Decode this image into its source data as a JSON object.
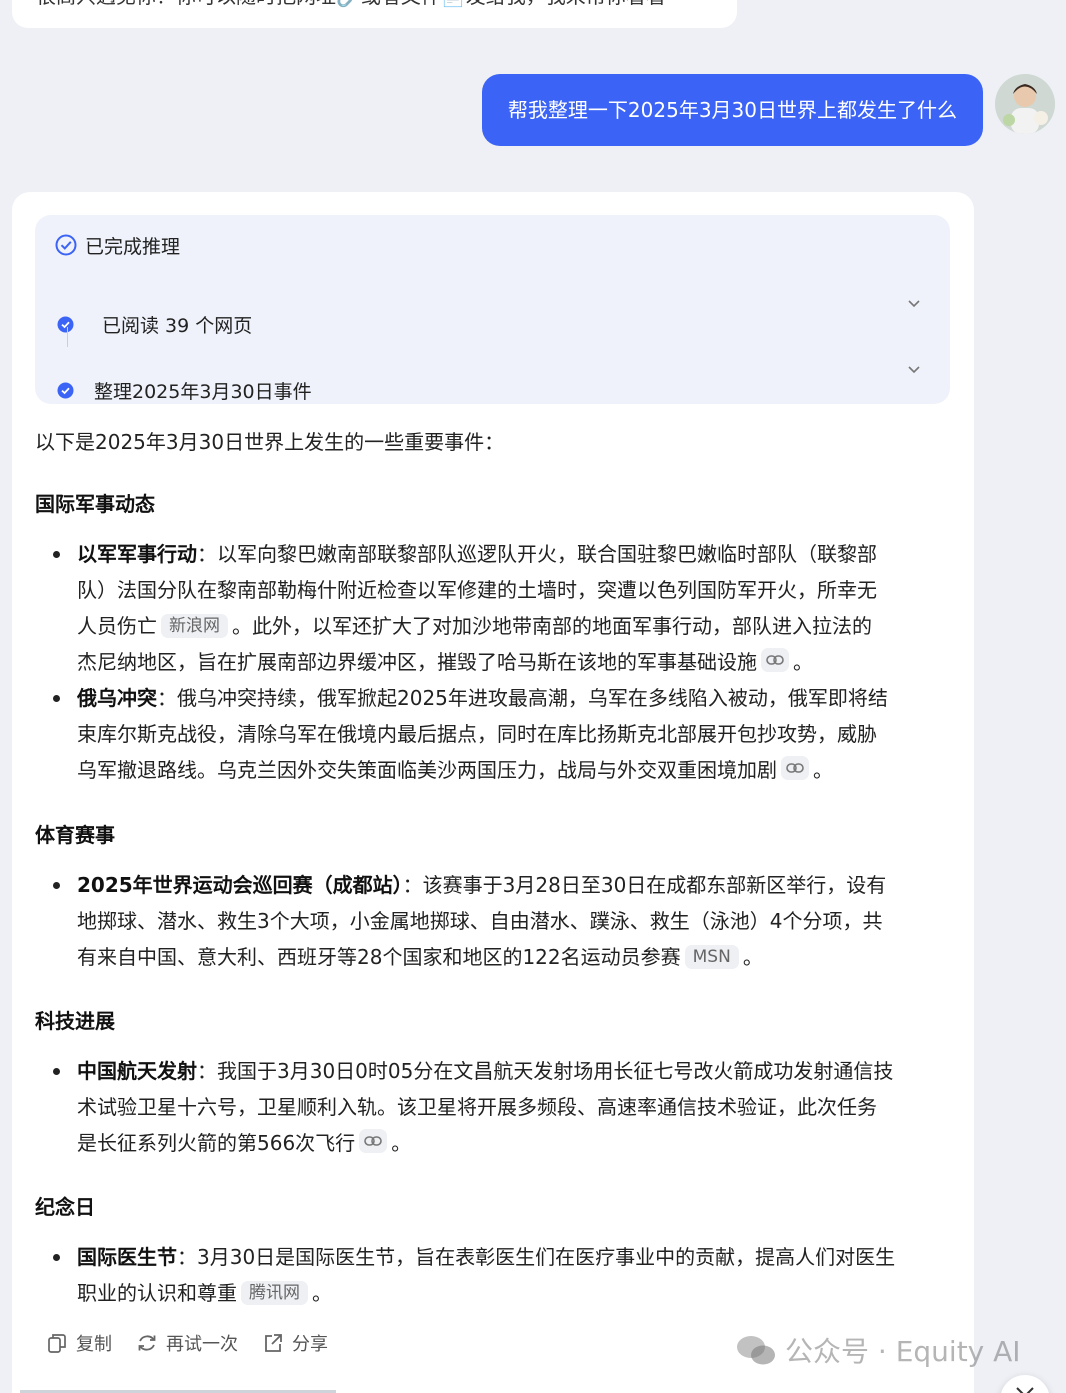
{
  "previous_message": "很高兴遇见你！你可以随时把网址🔗或者文件📄发给我，我来帮你看看",
  "user_message": "帮我整理一下2025年3月30日世界上都发生了什么",
  "reasoning": {
    "status": "已完成推理",
    "steps": [
      {
        "label": "已阅读 39 个网页"
      },
      {
        "label": "整理2025年3月30日事件"
      }
    ]
  },
  "answer": {
    "intro": "以下是2025年3月30日世界上发生的一些重要事件：",
    "sections": [
      {
        "title": "国际军事动态",
        "items": [
          {
            "heading": "以军军事行动",
            "line1": "：以军向黎巴嫩南部联黎部队巡逻队开火，联合国驻黎巴嫩临时部队（联黎部",
            "line2": "队）法国分队在黎南部勒梅什附近检查以军修建的土墙时，突遭以色列国防军开火，所幸无",
            "line3": "人员伤亡",
            "source": "新浪网",
            "line3b": "。此外，以军还扩大了对加沙地带南部的地面军事行动，部队进入拉法的",
            "line4": "杰尼纳地区，旨在扩展南部边界缓冲区，摧毁了哈马斯在该地的军事基础设施",
            "end": "。"
          },
          {
            "heading": "俄乌冲突",
            "line1": "：俄乌冲突持续，俄军掀起2025年进攻最高潮，乌军在多线陷入被动，俄军即将结",
            "line2": "束库尔斯克战役，清除乌军在俄境内最后据点，同时在库比扬斯克北部展开包抄攻势，威胁",
            "line3": "乌军撤退路线。乌克兰因外交失策面临美沙两国压力，战局与外交双重困境加剧",
            "end": "。"
          }
        ]
      },
      {
        "title": "体育赛事",
        "items": [
          {
            "heading": "2025年世界运动会巡回赛（成都站）",
            "line1": "：该赛事于3月28日至30日在成都东部新区举行，设有",
            "line2": "地掷球、潜水、救生3个大项，小金属地掷球、自由潜水、蹼泳、救生（泳池）4个分项，共",
            "line3": "有来自中国、意大利、西班牙等28个国家和地区的122名运动员参赛",
            "source": "MSN",
            "end": "。"
          }
        ]
      },
      {
        "title": "科技进展",
        "items": [
          {
            "heading": "中国航天发射",
            "line1": "：我国于3月30日0时05分在文昌航天发射场用长征七号改火箭成功发射通信技",
            "line2": "术试验卫星十六号，卫星顺利入轨。该卫星将开展多频段、高速率通信技术验证，此次任务",
            "line3": "是长征系列火箭的第566次飞行",
            "end": "。"
          }
        ]
      },
      {
        "title": "纪念日",
        "items": [
          {
            "heading": "国际医生节",
            "line1": "：3月30日是国际医生节，旨在表彰医生们在医疗事业中的贡献，提高人们对医生",
            "line2": "职业的认识和尊重",
            "source": "腾讯网",
            "end": "。"
          }
        ]
      }
    ]
  },
  "actions": {
    "copy": "复制",
    "retry": "再试一次",
    "share": "分享"
  },
  "watermark": "公众号 · Equity AI",
  "colors": {
    "accent": "#3b63f5",
    "background": "#eef0f5",
    "card": "#ffffff",
    "reasoning_bg": "#eff2fa"
  }
}
